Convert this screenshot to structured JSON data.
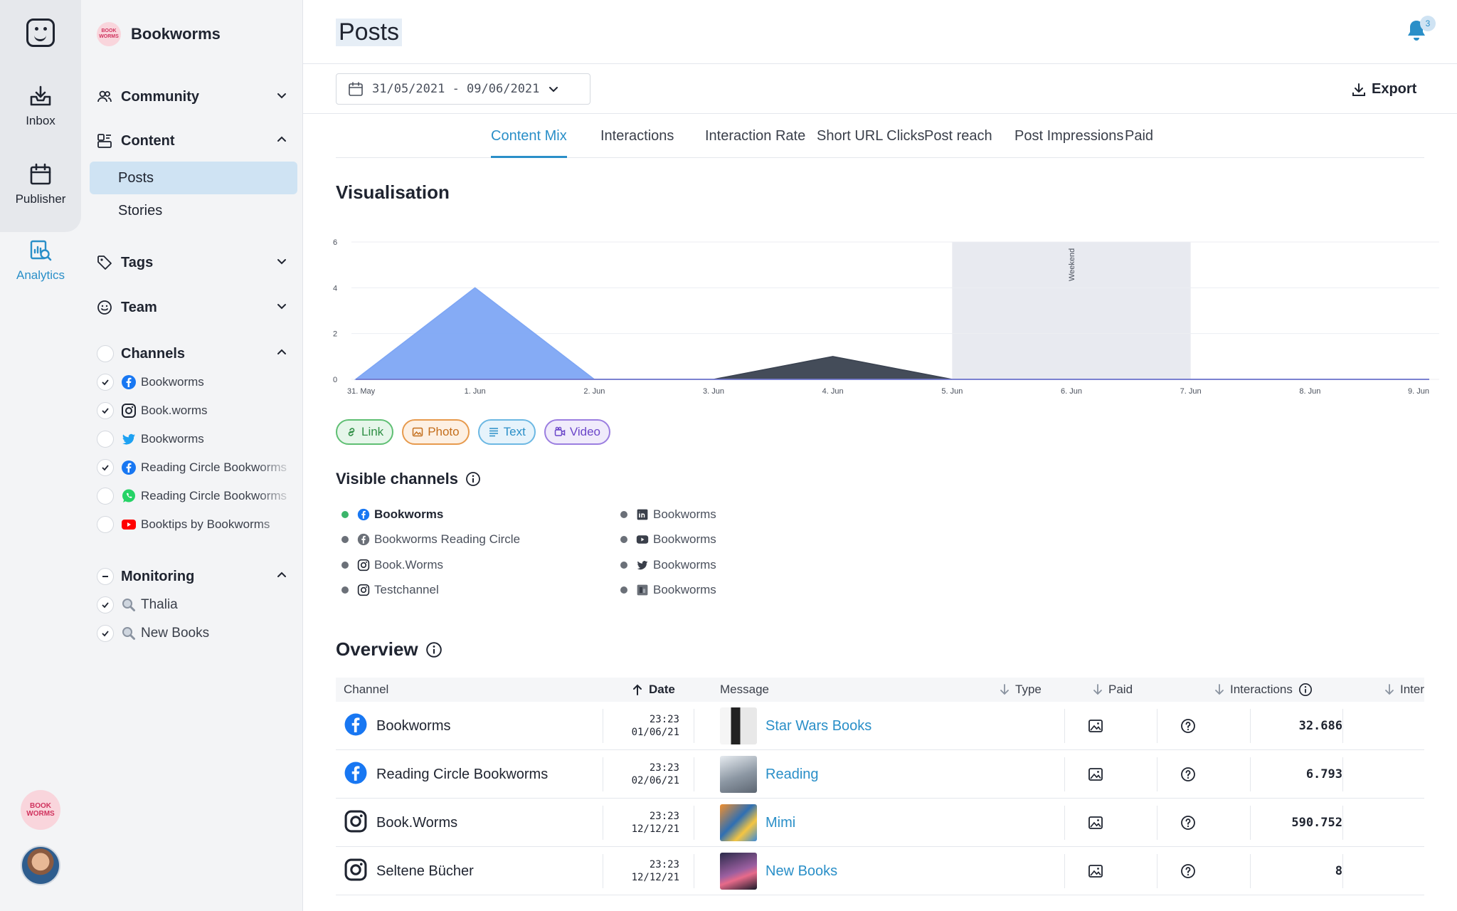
{
  "rail": {
    "items": [
      {
        "label": "Inbox",
        "icon": "inbox-icon"
      },
      {
        "label": "Publisher",
        "icon": "calendar-icon"
      },
      {
        "label": "Analytics",
        "icon": "analytics-icon"
      }
    ],
    "badge_text": "BOOK WORMS"
  },
  "sidebar": {
    "workspace": {
      "name": "Bookworms",
      "logo_text": "BOOK WORMS"
    },
    "community": "Community",
    "content": "Content",
    "content_items": [
      "Posts",
      "Stories"
    ],
    "tags": "Tags",
    "team": "Team",
    "channels_label": "Channels",
    "channels": [
      {
        "label": "Bookworms",
        "network": "facebook",
        "checked": true
      },
      {
        "label": "Book.worms",
        "network": "instagram",
        "checked": true
      },
      {
        "label": "Bookworms",
        "network": "twitter",
        "checked": false
      },
      {
        "label": "Reading Circle Bookworms",
        "network": "facebook",
        "checked": true
      },
      {
        "label": "Reading Circle Bookworms",
        "network": "whatsapp",
        "checked": false
      },
      {
        "label": "Booktips by Bookworms",
        "network": "youtube",
        "checked": false
      }
    ],
    "monitoring_label": "Monitoring",
    "monitoring": [
      {
        "label": "Thalia",
        "checked": true
      },
      {
        "label": "New Books",
        "checked": true
      }
    ]
  },
  "header": {
    "title": "Posts",
    "notification_count": "3",
    "date_range": "31/05/2021 - 09/06/2021",
    "export_label": "Export"
  },
  "tabs": [
    "Content Mix",
    "Interactions",
    "Interaction Rate",
    "Short URL Clicks",
    "Post reach",
    "Post Impressions",
    "Paid"
  ],
  "visualisation": {
    "title": "Visualisation",
    "legend": [
      "Link",
      "Photo",
      "Text",
      "Video"
    ]
  },
  "chart_data": {
    "type": "area",
    "categories": [
      "31. May",
      "1. Jun",
      "2. Jun",
      "3. Jun",
      "4. Jun",
      "5. Jun",
      "6. Jun",
      "7. Jun",
      "8. Jun",
      "9. Jun"
    ],
    "series": [
      {
        "name": "Photo",
        "color": "#7ea6f4",
        "values": [
          0,
          4,
          0,
          0,
          0,
          0,
          0,
          0,
          0,
          0
        ]
      },
      {
        "name": "Video",
        "color": "#3a4250",
        "values": [
          0,
          0,
          0,
          0,
          1,
          0,
          0,
          0,
          0,
          0
        ]
      }
    ],
    "yticks": [
      0,
      2,
      4,
      6
    ],
    "ylim": [
      0,
      6
    ],
    "band": {
      "from": "5. Jun",
      "to": "7. Jun",
      "label": "Weekend"
    }
  },
  "visible_channels": {
    "title": "Visible channels",
    "col1": [
      {
        "label": "Bookworms",
        "icon": "facebook-icon",
        "active": true
      },
      {
        "label": "Bookworms Reading Circle",
        "icon": "facebook-icon",
        "active": false
      },
      {
        "label": "Book.Worms",
        "icon": "instagram-icon",
        "active": false
      },
      {
        "label": "Testchannel",
        "icon": "instagram-icon",
        "active": false
      }
    ],
    "col2": [
      {
        "label": "Bookworms",
        "icon": "linkedin-icon"
      },
      {
        "label": "Bookworms",
        "icon": "youtube-icon"
      },
      {
        "label": "Bookworms",
        "icon": "twitter-icon"
      },
      {
        "label": "Bookworms",
        "icon": "pinterest-icon"
      }
    ]
  },
  "overview": {
    "title": "Overview",
    "columns": {
      "channel": "Channel",
      "date": "Date",
      "message": "Message",
      "type": "Type",
      "paid": "Paid",
      "interactions": "Interactions",
      "interactions2": "Inter"
    },
    "rows": [
      {
        "channel": "Bookworms",
        "network": "facebook",
        "time": "23:23",
        "date": "01/06/21",
        "message": "Star Wars Books",
        "interactions": "32.686"
      },
      {
        "channel": "Reading Circle Bookworms",
        "network": "facebook",
        "time": "23:23",
        "date": "02/06/21",
        "message": "Reading",
        "interactions": "6.793"
      },
      {
        "channel": "Book.Worms",
        "network": "instagram",
        "time": "23:23",
        "date": "12/12/21",
        "message": "Mimi",
        "interactions": "590.752"
      },
      {
        "channel": "Seltene Bücher",
        "network": "instagram",
        "time": "23:23",
        "date": "12/12/21",
        "message": "New Books",
        "interactions": "8"
      }
    ]
  }
}
